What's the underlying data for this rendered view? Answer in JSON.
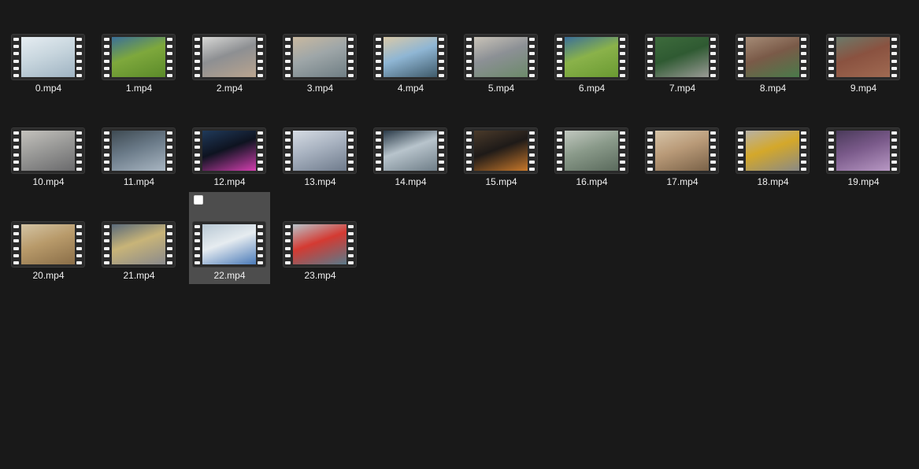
{
  "files": [
    {
      "name": "0.mp4",
      "thumb_colors": [
        "#c8d6de",
        "#9fb3c2",
        "#e6edf2"
      ]
    },
    {
      "name": "1.mp4",
      "thumb_colors": [
        "#7ea83c",
        "#5b8a2a",
        "#3a6f9a"
      ]
    },
    {
      "name": "2.mp4",
      "thumb_colors": [
        "#8d8f92",
        "#b9a48f",
        "#d8d8d6"
      ]
    },
    {
      "name": "3.mp4",
      "thumb_colors": [
        "#9ea6a8",
        "#6f7e84",
        "#c9b9a0"
      ]
    },
    {
      "name": "4.mp4",
      "thumb_colors": [
        "#8fb6d4",
        "#3f5a6a",
        "#d9c9a8"
      ]
    },
    {
      "name": "5.mp4",
      "thumb_colors": [
        "#8c9095",
        "#6c8a6a",
        "#c9c3b8"
      ]
    },
    {
      "name": "6.mp4",
      "thumb_colors": [
        "#8ab24a",
        "#6a9a32",
        "#3a6f9a"
      ]
    },
    {
      "name": "7.mp4",
      "thumb_colors": [
        "#2f5a32",
        "#9a9a96",
        "#3d6b3c"
      ]
    },
    {
      "name": "8.mp4",
      "thumb_colors": [
        "#7a5a48",
        "#4a7a4a",
        "#a58b76"
      ]
    },
    {
      "name": "9.mp4",
      "thumb_colors": [
        "#8a5240",
        "#a06a52",
        "#6b7a6a"
      ]
    },
    {
      "name": "10.mp4",
      "thumb_colors": [
        "#9a9a98",
        "#6a6a6c",
        "#c4c2bd"
      ]
    },
    {
      "name": "11.mp4",
      "thumb_colors": [
        "#6a7a88",
        "#a9b6c2",
        "#3e4a52"
      ]
    },
    {
      "name": "12.mp4",
      "thumb_colors": [
        "#0e1320",
        "#d43fb0",
        "#203a5a"
      ]
    },
    {
      "name": "13.mp4",
      "thumb_colors": [
        "#a8b2c0",
        "#6f7b8c",
        "#d6dce4"
      ]
    },
    {
      "name": "14.mp4",
      "thumb_colors": [
        "#b8c4cc",
        "#6f7e88",
        "#2a3a48"
      ]
    },
    {
      "name": "15.mp4",
      "thumb_colors": [
        "#1e1a18",
        "#c8782a",
        "#4a3a2a"
      ]
    },
    {
      "name": "16.mp4",
      "thumb_colors": [
        "#8a9a8a",
        "#5a6a5c",
        "#c2c8c0"
      ]
    },
    {
      "name": "17.mp4",
      "thumb_colors": [
        "#b99a78",
        "#7a6248",
        "#d6c4a8"
      ]
    },
    {
      "name": "18.mp4",
      "thumb_colors": [
        "#d4a82a",
        "#8a8a86",
        "#b8b2a6"
      ]
    },
    {
      "name": "19.mp4",
      "thumb_colors": [
        "#7a5a8a",
        "#b898c4",
        "#4a3a5a"
      ]
    },
    {
      "name": "20.mp4",
      "thumb_colors": [
        "#b89a6a",
        "#8a6e48",
        "#d4c4a4"
      ]
    },
    {
      "name": "21.mp4",
      "thumb_colors": [
        "#c8b478",
        "#8a8a8c",
        "#5a6a7a"
      ]
    },
    {
      "name": "22.mp4",
      "thumb_colors": [
        "#e6ecf0",
        "#4a7ab8",
        "#b8c8d4"
      ],
      "selected": true
    },
    {
      "name": "23.mp4",
      "thumb_colors": [
        "#d43a32",
        "#5a7a8a",
        "#b8c4ca"
      ]
    }
  ]
}
